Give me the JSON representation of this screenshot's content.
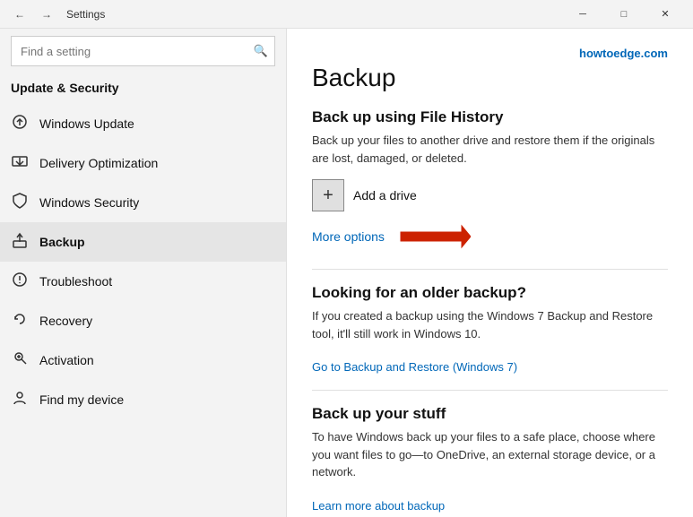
{
  "titlebar": {
    "back_label": "←",
    "forward_label": "→",
    "title": "Settings",
    "min_label": "─",
    "max_label": "□",
    "close_label": "✕"
  },
  "sidebar": {
    "search_placeholder": "Find a setting",
    "search_icon": "🔍",
    "section_title": "Update & Security",
    "items": [
      {
        "id": "windows-update",
        "icon": "⬆",
        "label": "Windows Update"
      },
      {
        "id": "delivery-optimization",
        "icon": "⬇",
        "label": "Delivery Optimization"
      },
      {
        "id": "windows-security",
        "icon": "🛡",
        "label": "Windows Security"
      },
      {
        "id": "backup",
        "icon": "↑",
        "label": "Backup",
        "active": true
      },
      {
        "id": "troubleshoot",
        "icon": "⚙",
        "label": "Troubleshoot"
      },
      {
        "id": "recovery",
        "icon": "↺",
        "label": "Recovery"
      },
      {
        "id": "activation",
        "icon": "🔑",
        "label": "Activation"
      },
      {
        "id": "find-my-device",
        "icon": "👤",
        "label": "Find my device"
      }
    ]
  },
  "content": {
    "brand": "howtoedge.com",
    "page_title": "Backup",
    "file_history": {
      "heading": "Back up using File History",
      "desc": "Back up your files to another drive and restore them if the originals are lost, damaged, or deleted.",
      "add_drive_label": "Add a drive",
      "more_options": "More options"
    },
    "older_backup": {
      "heading": "Looking for an older backup?",
      "desc": "If you created a backup using the Windows 7 Backup and Restore tool, it'll still work in Windows 10.",
      "link": "Go to Backup and Restore (Windows 7)"
    },
    "backup_stuff": {
      "heading": "Back up your stuff",
      "desc": "To have Windows back up your files to a safe place, choose where you want files to go—to OneDrive, an external storage device, or a network.",
      "link": "Learn more about backup"
    }
  }
}
